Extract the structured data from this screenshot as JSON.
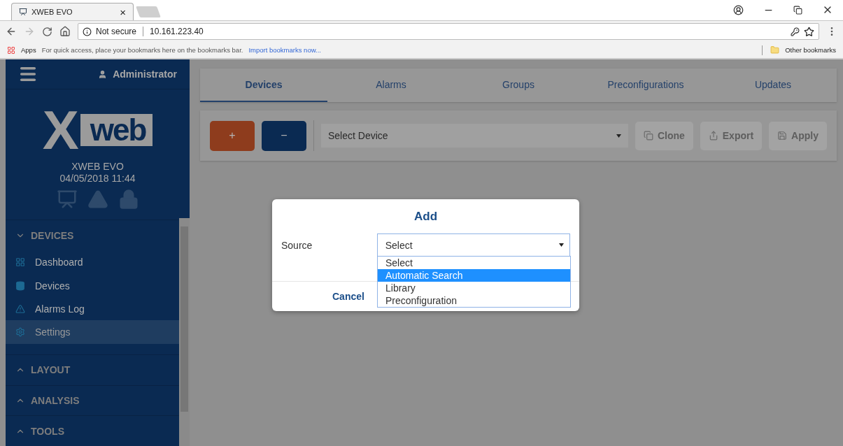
{
  "browser": {
    "tab": {
      "title": "XWEB EVO",
      "close": "×"
    },
    "security": "Not secure",
    "url": "10.161.223.40",
    "bookmarks": {
      "apps": "Apps",
      "hint": "For quick access, place your bookmarks here on the bookmarks bar.",
      "import_link": "Import bookmarks now...",
      "other": "Other bookmarks"
    }
  },
  "sidebar": {
    "user": "Administrator",
    "logo": {
      "mark": "X",
      "word": "web"
    },
    "device_name": "XWEB EVO",
    "datetime": "04/05/2018 11:44",
    "sections": [
      {
        "title": "DEVICES",
        "expanded": true,
        "items": [
          {
            "label": "Dashboard",
            "selected": false
          },
          {
            "label": "Devices",
            "selected": false
          },
          {
            "label": "Alarms Log",
            "selected": false
          },
          {
            "label": "Settings",
            "selected": true
          }
        ]
      },
      {
        "title": "LAYOUT",
        "expanded": false
      },
      {
        "title": "ANALYSIS",
        "expanded": false
      },
      {
        "title": "TOOLS",
        "expanded": false
      }
    ]
  },
  "tabs": [
    {
      "label": "Devices",
      "selected": true
    },
    {
      "label": "Alarms",
      "selected": false
    },
    {
      "label": "Groups",
      "selected": false
    },
    {
      "label": "Preconfigurations",
      "selected": false
    },
    {
      "label": "Updates",
      "selected": false
    }
  ],
  "toolbar": {
    "add": "+",
    "remove": "−",
    "device_select": "Select Device",
    "actions": [
      {
        "label": "Clone",
        "disabled": true
      },
      {
        "label": "Export",
        "disabled": true
      },
      {
        "label": "Apply",
        "disabled": true
      }
    ]
  },
  "dialog": {
    "title": "Add",
    "field_label": "Source",
    "value": "Select",
    "options": [
      {
        "label": "Select",
        "highlighted": false
      },
      {
        "label": "Automatic Search",
        "highlighted": true
      },
      {
        "label": "Library",
        "highlighted": false
      },
      {
        "label": "Preconfiguration",
        "highlighted": false
      }
    ],
    "cancel": "Cancel"
  }
}
